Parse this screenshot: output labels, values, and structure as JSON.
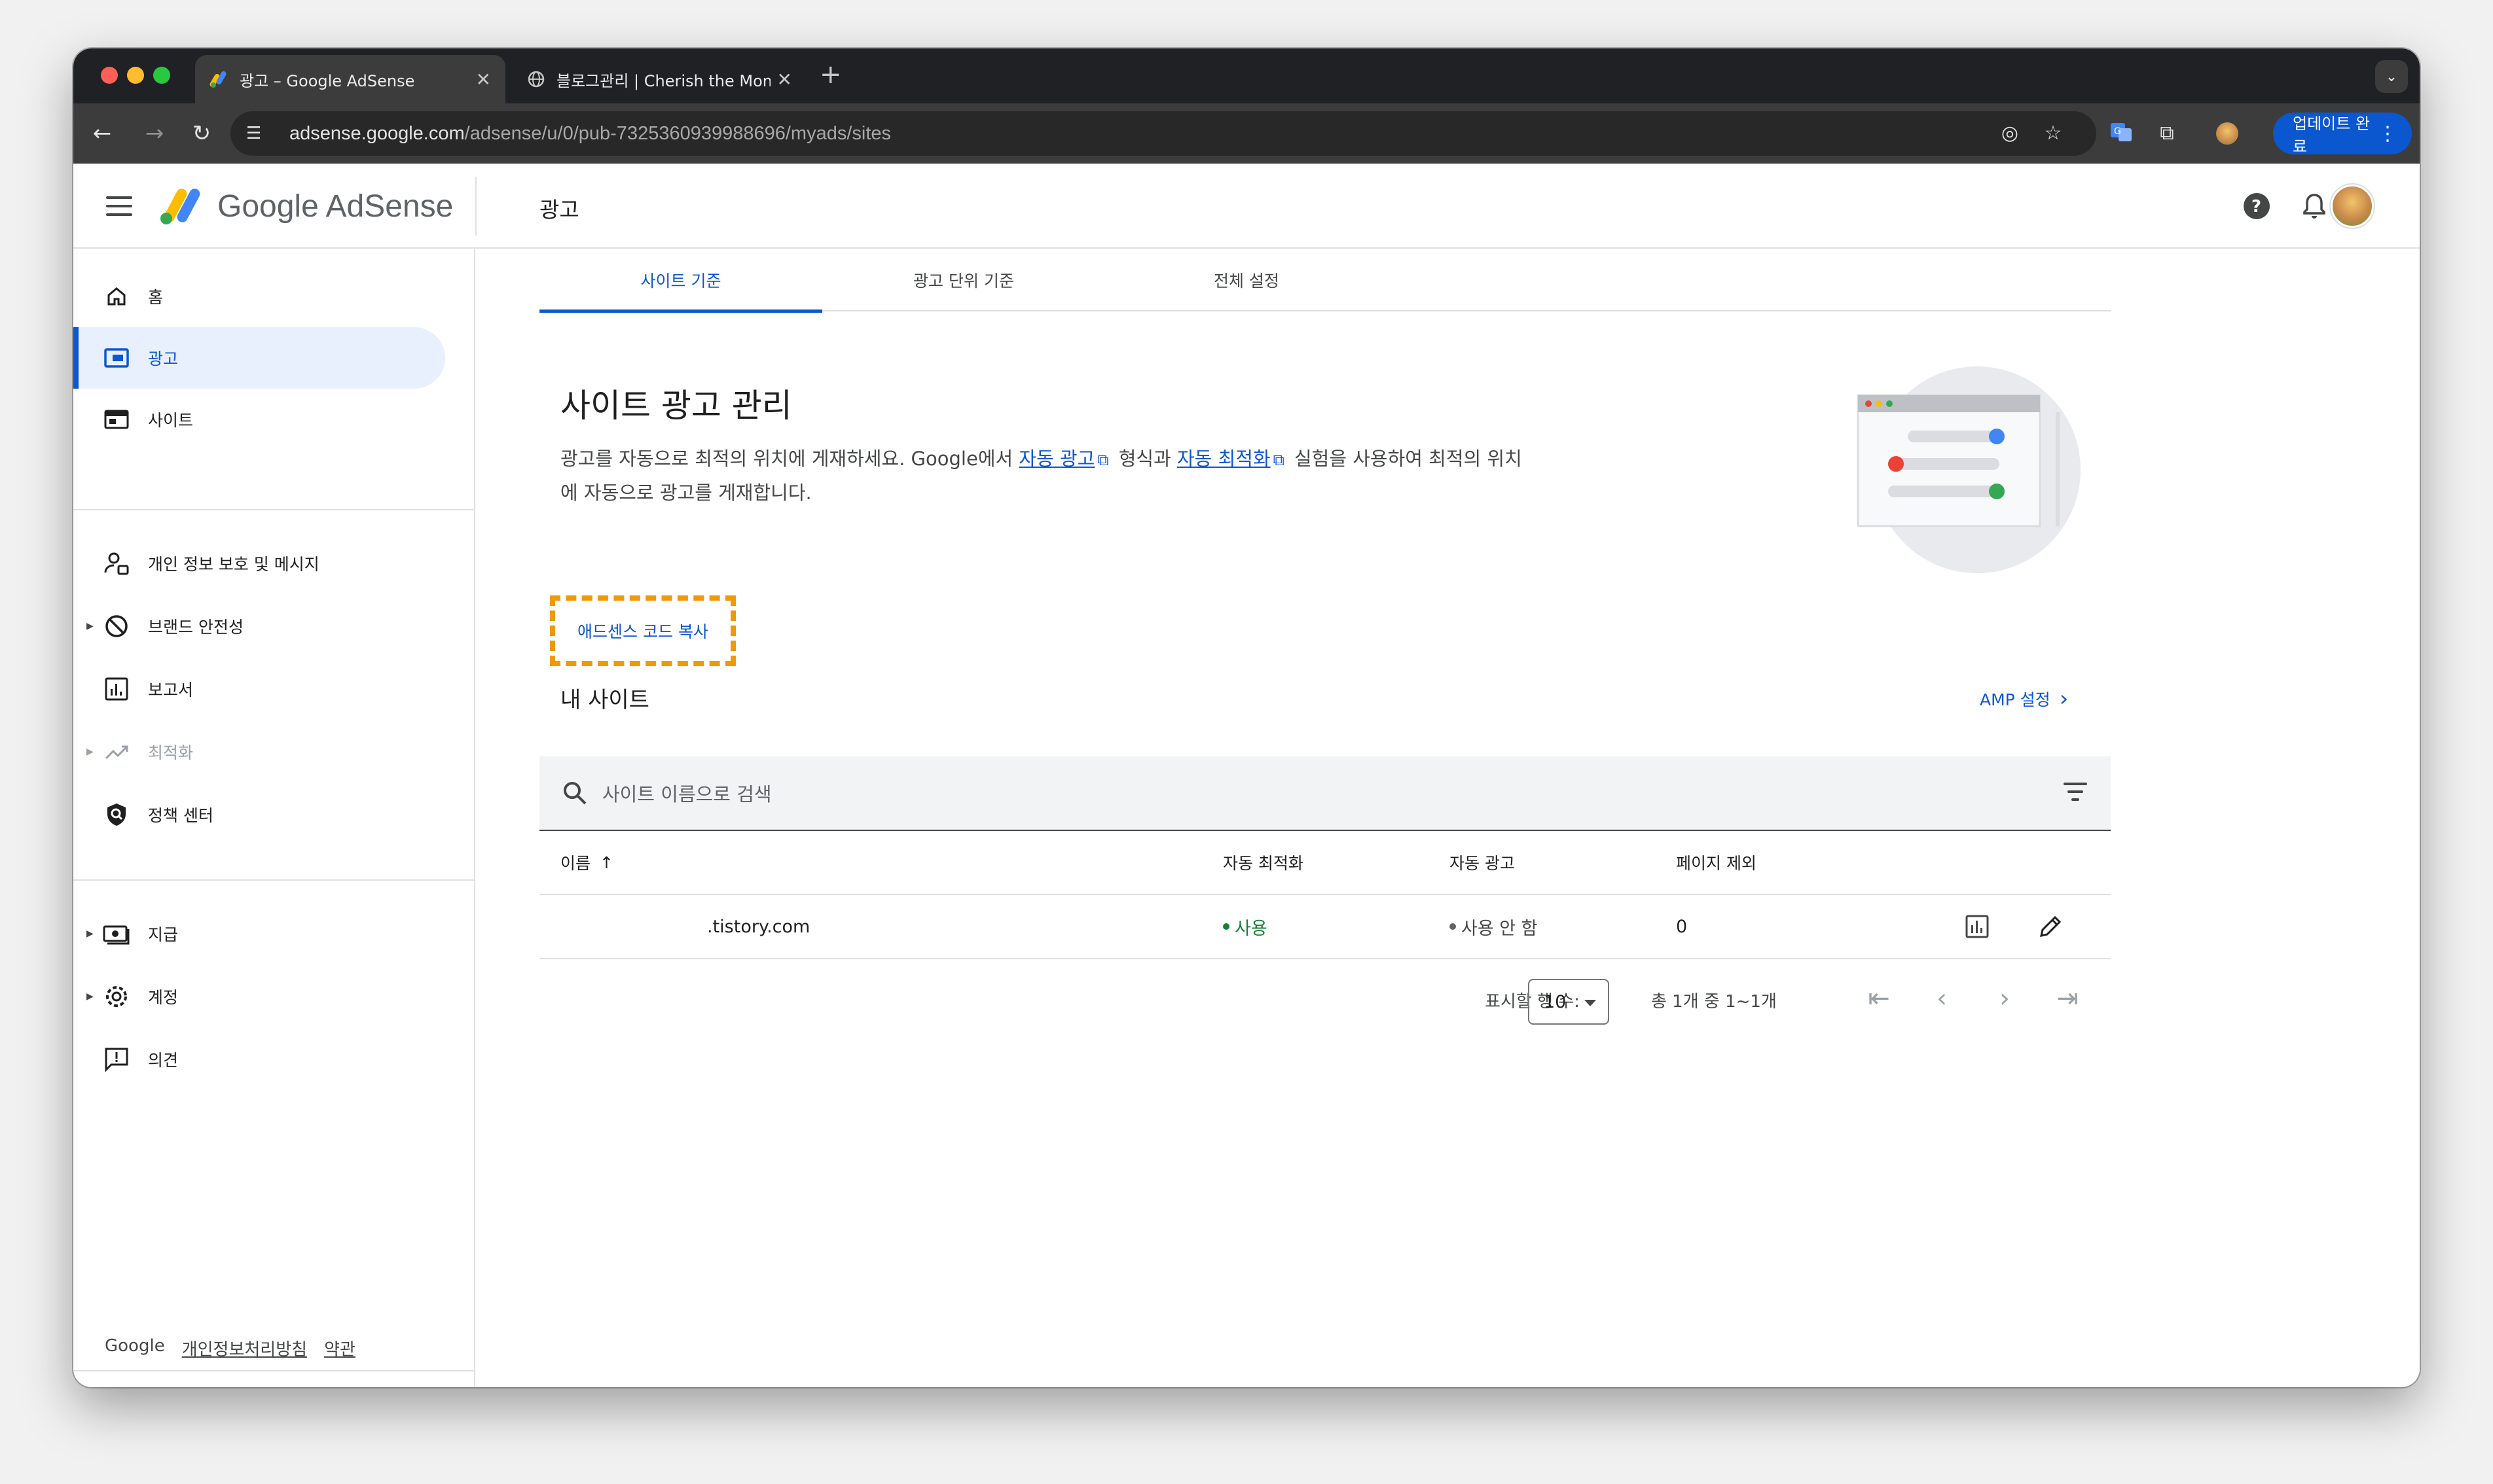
{
  "browser": {
    "tabs": [
      {
        "label": "광고 – Google AdSense",
        "active": true
      },
      {
        "label": "블로그관리 | Cherish the Mome",
        "active": false
      }
    ],
    "new_tab_symbol": "+",
    "url_domain": "adsense.google.com",
    "url_path": "/adsense/u/0/pub-7325360939988696/myads/sites",
    "update_button_label": "업데이트 완료"
  },
  "header": {
    "brand": "Google AdSense",
    "page_title": "광고"
  },
  "sidebar": {
    "items": [
      {
        "label": "홈",
        "icon": "home-icon"
      },
      {
        "label": "광고",
        "icon": "ads-icon",
        "active": true
      },
      {
        "label": "사이트",
        "icon": "sites-icon"
      },
      {
        "label": "개인 정보 보호 및 메시지",
        "icon": "privacy-icon"
      },
      {
        "label": "브랜드 안전성",
        "icon": "block-icon",
        "expandable": true
      },
      {
        "label": "보고서",
        "icon": "reports-icon"
      },
      {
        "label": "최적화",
        "icon": "trending-icon",
        "expandable": true,
        "disabled": true
      },
      {
        "label": "정책 센터",
        "icon": "policy-shield-icon"
      },
      {
        "label": "지급",
        "icon": "payments-icon",
        "expandable": true
      },
      {
        "label": "계정",
        "icon": "settings-gear-icon",
        "expandable": true
      },
      {
        "label": "의견",
        "icon": "feedback-icon"
      }
    ],
    "footer": {
      "brand": "Google",
      "privacy": "개인정보처리방침",
      "terms": "약관"
    }
  },
  "main": {
    "tabs": [
      {
        "label": "사이트 기준",
        "active": true
      },
      {
        "label": "광고 단위 기준"
      },
      {
        "label": "전체 설정"
      }
    ],
    "heading": "사이트 광고 관리",
    "desc_part1": "광고를 자동으로 최적의 위치에 게재하세요. Google에서 ",
    "desc_link1": "자동 광고",
    "desc_part2": " 형식과 ",
    "desc_link2": "자동 최적화",
    "desc_part3": " 실험을 사용하여 최적의 위치에 자동으로 광고를 게재합니다.",
    "copy_code_button": "애드센스 코드 복사",
    "my_sites": "내 사이트",
    "amp_settings": "AMP 설정",
    "search_placeholder": "사이트 이름으로 검색",
    "table": {
      "columns": [
        "이름",
        "자동 최적화",
        "자동 광고",
        "페이지 제외"
      ],
      "sort_indicator": "↑",
      "rows": [
        {
          "name": ".tistory.com",
          "auto_optimization": "사용",
          "auto_ads": "사용 안 함",
          "excluded_pages": "0"
        }
      ]
    },
    "pager": {
      "rows_label": "표시할 행 수:",
      "rows_value": "10",
      "range": "총 1개 중 1~1개"
    }
  },
  "colors": {
    "accent": "#0b57d0",
    "highlight_border": "#f29900",
    "status_on": "#188038",
    "status_off": "#5f6368"
  }
}
